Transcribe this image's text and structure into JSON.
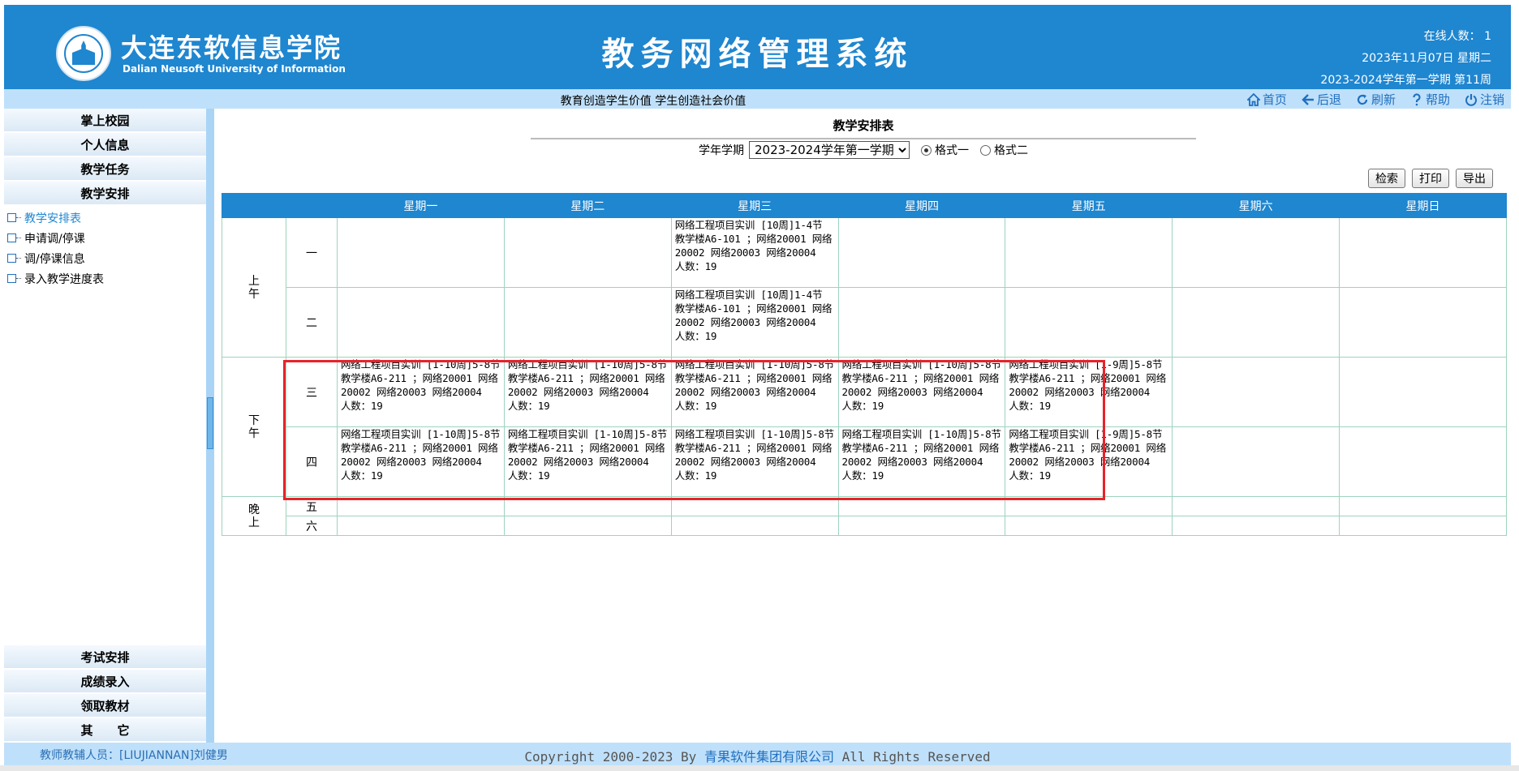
{
  "header": {
    "logo_cn": "大连东软信息学院",
    "logo_en": "Dalian Neusoft University of Information",
    "system_title": "教务网络管理系统",
    "online_count": "在线人数： 1",
    "date": "2023年11月07日 星期二",
    "term_week": "2023-2024学年第一学期 第11周"
  },
  "subbar": {
    "motto": "教育创造学生价值  学生创造社会价值",
    "toolbar": [
      {
        "label": "首页",
        "icon": "home-icon"
      },
      {
        "label": "后退",
        "icon": "back-arrow-icon"
      },
      {
        "label": "刷新",
        "icon": "refresh-icon"
      },
      {
        "label": "帮助",
        "icon": "help-icon"
      },
      {
        "label": "注销",
        "icon": "power-icon"
      }
    ]
  },
  "sidebar": {
    "top_menus": [
      "掌上校园",
      "个人信息",
      "教学任务",
      "教学安排"
    ],
    "sub_items": [
      "教学安排表",
      "申请调/停课",
      "调/停课信息",
      "录入教学进度表"
    ],
    "active_sub": 0,
    "bottom_menus": [
      "考试安排",
      "成绩录入",
      "领取教材",
      "其　　它"
    ]
  },
  "main": {
    "title": "教学安排表",
    "term_label": "学年学期",
    "term_value": "2023-2024学年第一学期",
    "format1": "格式一",
    "format2": "格式二",
    "format_selected": 1,
    "buttons": {
      "search": "检索",
      "print": "打印",
      "export": "导出"
    },
    "days": [
      "星期一",
      "星期二",
      "星期三",
      "星期四",
      "星期五",
      "星期六",
      "星期日"
    ],
    "segments": [
      "上午",
      "下午",
      "晚上"
    ],
    "periods": [
      "一",
      "二",
      "三",
      "四",
      "五",
      "六"
    ],
    "schedule": {
      "p1": [
        "",
        "",
        "网络工程项目实训 [10周]1-4节 教学楼A6-101 ；网络20001 网络20002 网络20003 网络20004\n人数：19",
        "",
        "",
        "",
        ""
      ],
      "p2": [
        "",
        "",
        "网络工程项目实训 [10周]1-4节 教学楼A6-101 ；网络20001 网络20002 网络20003 网络20004\n人数：19",
        "",
        "",
        "",
        ""
      ],
      "p3": [
        "网络工程项目实训 [1-10周]5-8节 教学楼A6-211 ；网络20001 网络20002 网络20003 网络20004\n人数：19",
        "网络工程项目实训 [1-10周]5-8节 教学楼A6-211 ；网络20001 网络20002 网络20003 网络20004\n人数：19",
        "网络工程项目实训 [1-10周]5-8节 教学楼A6-211 ；网络20001 网络20002 网络20003 网络20004\n人数：19",
        "网络工程项目实训 [1-10周]5-8节 教学楼A6-211 ；网络20001 网络20002 网络20003 网络20004\n人数：19",
        "网络工程项目实训 [1-9周]5-8节 教学楼A6-211 ；网络20001 网络20002 网络20003 网络20004\n人数：19",
        "",
        ""
      ],
      "p4": [
        "网络工程项目实训 [1-10周]5-8节 教学楼A6-211 ；网络20001 网络20002 网络20003 网络20004\n人数：19",
        "网络工程项目实训 [1-10周]5-8节 教学楼A6-211 ；网络20001 网络20002 网络20003 网络20004\n人数：19",
        "网络工程项目实训 [1-10周]5-8节 教学楼A6-211 ；网络20001 网络20002 网络20003 网络20004\n人数：19",
        "网络工程项目实训 [1-10周]5-8节 教学楼A6-211 ；网络20001 网络20002 网络20003 网络20004\n人数：19",
        "网络工程项目实训 [1-9周]5-8节 教学楼A6-211 ；网络20001 网络20002 网络20003 网络20004\n人数：19",
        "",
        ""
      ],
      "p5": [
        "",
        "",
        "",
        "",
        "",
        "",
        ""
      ],
      "p6": [
        "",
        "",
        "",
        "",
        "",
        "",
        ""
      ]
    }
  },
  "footer": {
    "teacher": "教师教辅人员：[LIUJIANNAN]刘健男",
    "copyright_pre": "Copyright 2000-2023 By ",
    "copyright_company": "青果软件集团有限公司",
    "copyright_post": " All Rights Reserved"
  },
  "colors": {
    "header_bg": "#1f86d0",
    "subbar_bg": "#bfe0fa",
    "highlight": "#e8232a",
    "grid": "#9ed3bd"
  }
}
